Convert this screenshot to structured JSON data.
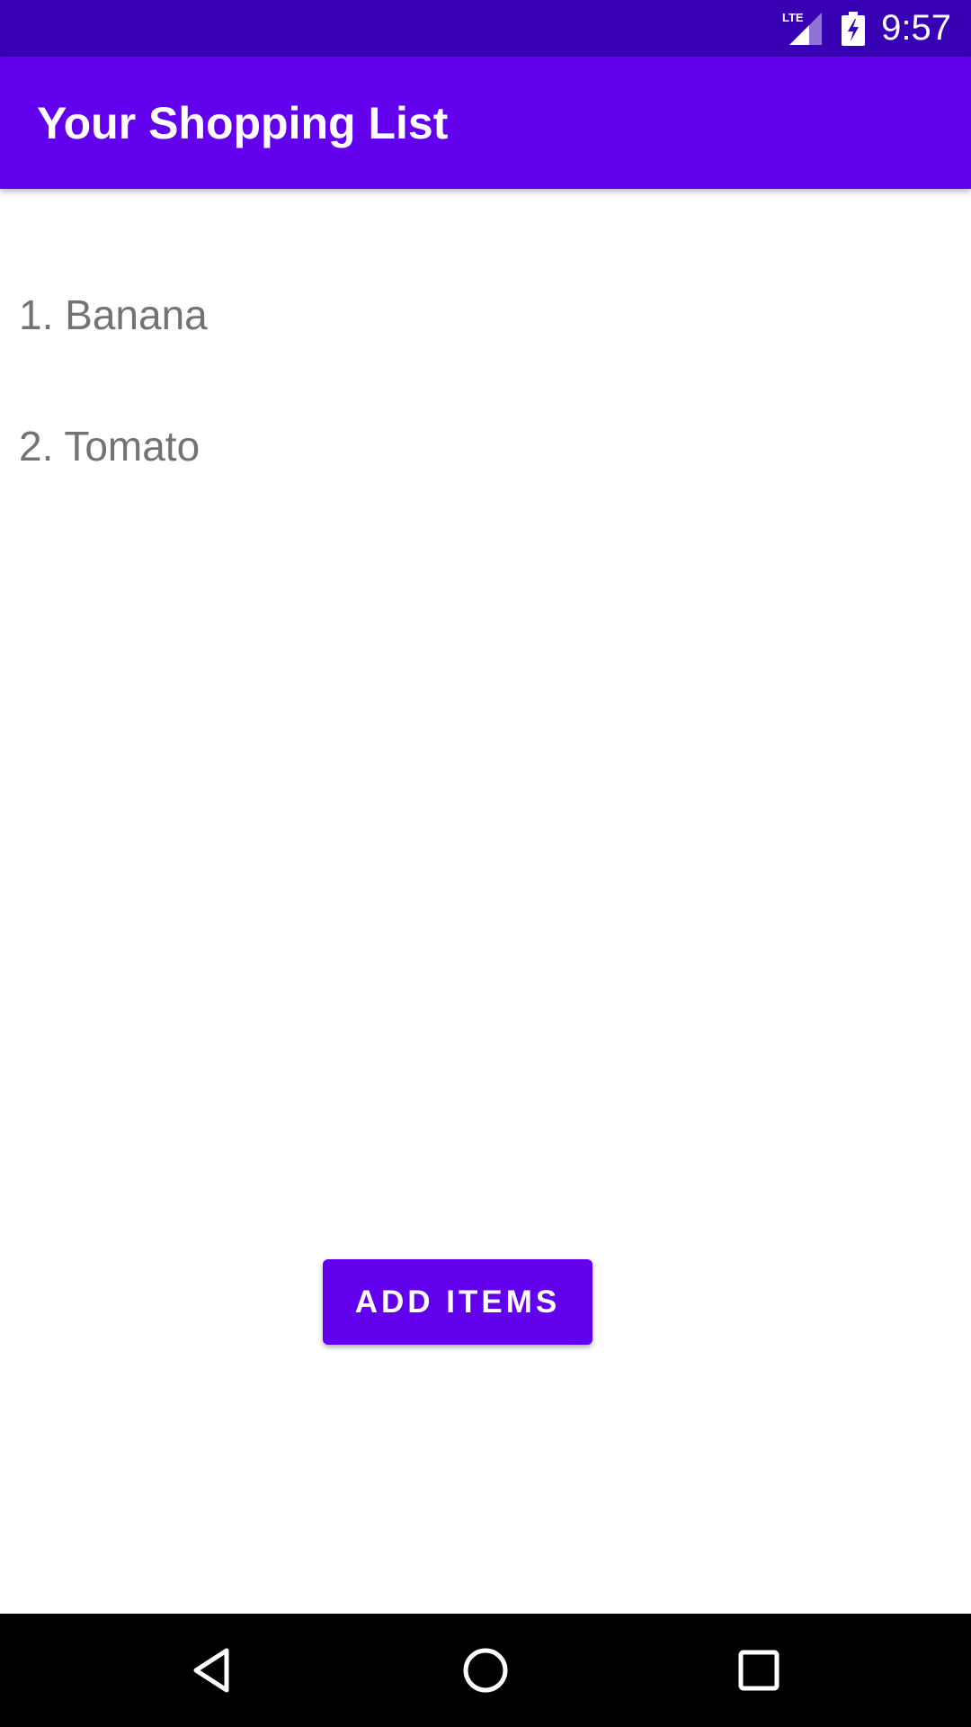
{
  "status_bar": {
    "network_label": "LTE",
    "time": "9:57",
    "icons": [
      "lte-signal-icon",
      "battery-charging-icon"
    ]
  },
  "app_bar": {
    "title": "Your Shopping List"
  },
  "shopping_list": {
    "items": [
      {
        "label": "1. Banana"
      },
      {
        "label": "2. Tomato"
      }
    ]
  },
  "actions": {
    "add_items_label": "ADD ITEMS"
  },
  "nav_bar": {
    "icons": [
      "back-icon",
      "home-icon",
      "recents-icon"
    ]
  },
  "colors": {
    "status_bar": "#3700b3",
    "primary": "#6200ee",
    "item_text": "#737373",
    "nav_bar": "#000000"
  }
}
